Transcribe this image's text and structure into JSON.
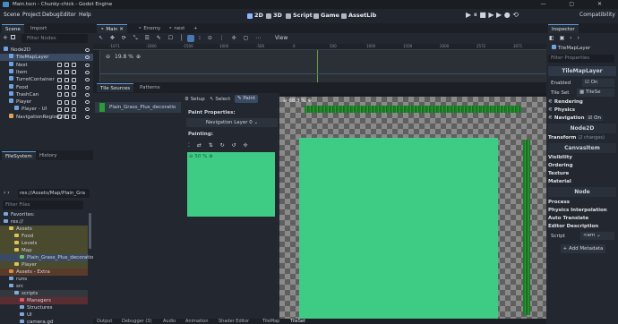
{
  "window": {
    "title": "Main.tscn - Chunky-chick - Godot Engine",
    "controls": "— ▢ ✕"
  },
  "menu": [
    "Scene",
    "Project",
    "Debug",
    "Editor",
    "Help"
  ],
  "workspaces": [
    "2D",
    "3D",
    "Script",
    "Game",
    "AssetLib"
  ],
  "renderer": "Compatibility",
  "scene_dock": {
    "tabs": [
      "Scene",
      "Import"
    ],
    "filter_placeholder": "Filter Nodes",
    "nodes": [
      {
        "label": "Node2D",
        "depth": 0
      },
      {
        "label": "TileMapLayer",
        "depth": 1,
        "selected": true
      },
      {
        "label": "Nest",
        "depth": 1
      },
      {
        "label": "Item",
        "depth": 1
      },
      {
        "label": "TurretContainer",
        "depth": 1
      },
      {
        "label": "Food",
        "depth": 1
      },
      {
        "label": "TrashCan",
        "depth": 1
      },
      {
        "label": "Player",
        "depth": 1
      },
      {
        "label": "Player - UI",
        "depth": 2
      },
      {
        "label": "NavigationRegion2D",
        "depth": 1
      }
    ]
  },
  "filesystem": {
    "tabs": [
      "FileSystem",
      "History"
    ],
    "path": "res://Assets/Map/Plain_Gra",
    "filter_placeholder": "Filter Files",
    "rows": [
      {
        "label": "Favorites:",
        "depth": 0
      },
      {
        "label": "res://",
        "depth": 0
      },
      {
        "label": "Assets",
        "depth": 1,
        "hl": "yellow"
      },
      {
        "label": "Food",
        "depth": 2,
        "hl": "yellow"
      },
      {
        "label": "Levels",
        "depth": 2,
        "hl": "yellow"
      },
      {
        "label": "Map",
        "depth": 2,
        "hl": "yellow"
      },
      {
        "label": "Plain_Grass_Plus_decoratio",
        "depth": 3,
        "hl": "sel"
      },
      {
        "label": "Player",
        "depth": 2,
        "hl": "yellow"
      },
      {
        "label": "Assets - Extra",
        "depth": 1,
        "hl": "orange"
      },
      {
        "label": "runs",
        "depth": 1
      },
      {
        "label": "src",
        "depth": 1
      },
      {
        "label": "scripts",
        "depth": 2,
        "hl": "dk"
      },
      {
        "label": "Managers",
        "depth": 3,
        "hl": "red"
      },
      {
        "label": "Structures",
        "depth": 3
      },
      {
        "label": "UI",
        "depth": 3
      },
      {
        "label": "camera.gd",
        "depth": 3
      }
    ]
  },
  "editor_tabs": [
    "Main",
    "Enemy",
    "nest"
  ],
  "toolbar": {
    "view_label": "View"
  },
  "ruler": [
    "-1071",
    "-2000",
    "-1500",
    "1000",
    "-500",
    "0",
    "500",
    "1000",
    "1500",
    "2000",
    "2572",
    "3071"
  ],
  "zoom": "19.8 %",
  "tileset_panel": {
    "tabs": [
      "Tile Sources",
      "Patterns"
    ],
    "source_name": "Plain_Grass_Plus_decoratio",
    "setup": "Setup",
    "select": "Select",
    "paint": "Paint",
    "paint_props": "Paint Properties:",
    "nav_layer": "Navigation Layer 0",
    "painting": "Painting:",
    "inner_zoom": "68.3 %",
    "preview_zoom": "50 %"
  },
  "bottom_tabs": [
    "Output",
    "Debugger (3)",
    "Audio",
    "Animation",
    "Shader Editor",
    "TileMap",
    "TileSet"
  ],
  "inspector": {
    "title": "Inspector",
    "node_type": "TileMapLayer",
    "filter_placeholder": "Filter Properties",
    "class_label": "TileMapLayer",
    "enabled_label": "Enabled",
    "enabled_value": "On",
    "tileset_label": "Tile Set",
    "tileset_value": "TileSe",
    "sections": [
      "Rendering",
      "Physics",
      "Navigation"
    ],
    "navigation_value": "On",
    "node2d": "Node2D",
    "transform": "Transform",
    "transform_note": "(2 changes)",
    "canvasitem": "CanvasItem",
    "ci_sections": [
      "Visibility",
      "Ordering",
      "Texture",
      "Material"
    ],
    "node": "Node",
    "node_sections": [
      "Process",
      "Physics Interpolation",
      "Auto Translate",
      "Editor Description"
    ],
    "script_label": "Script",
    "script_value": "<em",
    "add_metadata": "Add Metadata"
  },
  "colors": {
    "accent": "#478cbf",
    "grass": "#3ecc85",
    "selection": "#3a4a63"
  }
}
